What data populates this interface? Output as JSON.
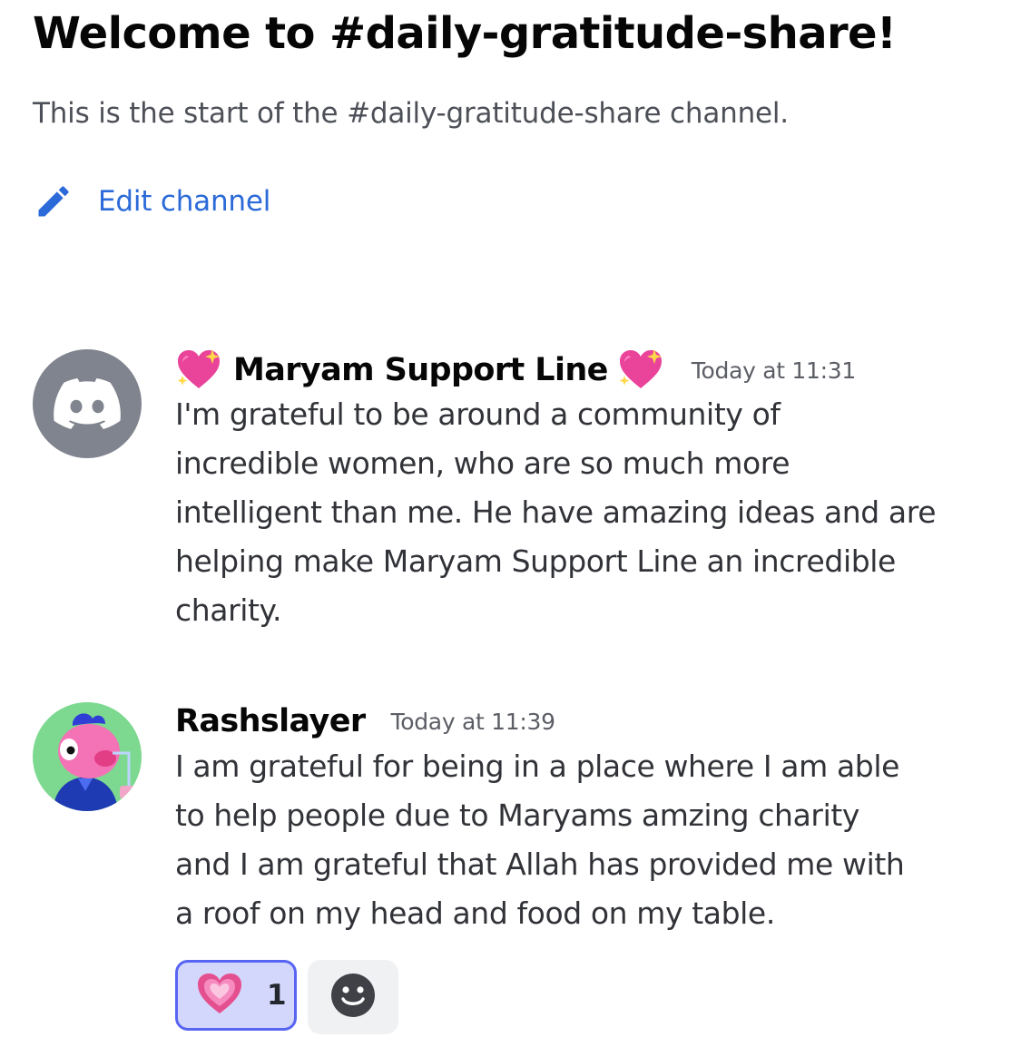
{
  "channel": {
    "welcome_title": "Welcome to #daily-gratitude-share!",
    "welcome_subtitle": "This is the start of the #daily-gratitude-share channel.",
    "edit_label": "Edit channel"
  },
  "messages": [
    {
      "author": "Maryam Support Line",
      "author_emoji": "sparkling-heart",
      "timestamp": "Today at 11:31",
      "avatar": "discord-logo",
      "lines": [
        "I'm grateful to be around a community of",
        "incredible women, who are so much more",
        "intelligent than me. He have amazing ideas and are",
        "helping make Maryam Support Line an incredible",
        "charity."
      ]
    },
    {
      "author": "Rashslayer",
      "timestamp": "Today at 11:39",
      "avatar": "pink-character-avatar",
      "lines": [
        "I am grateful for being in a place where I am able",
        "to help people due to Maryams amzing charity",
        "and I am grateful that Allah has provided me with",
        "a roof on my head and food on my table."
      ],
      "reactions": [
        {
          "emoji": "heartpulse",
          "count": "1",
          "selected": true
        }
      ]
    }
  ],
  "colors": {
    "link": "#2b6ad8",
    "reaction_border": "#5865f2",
    "reaction_bg": "#d4d7fc",
    "discord_avatar_bg": "#80848e",
    "avatar_green": "#7dd98f"
  }
}
